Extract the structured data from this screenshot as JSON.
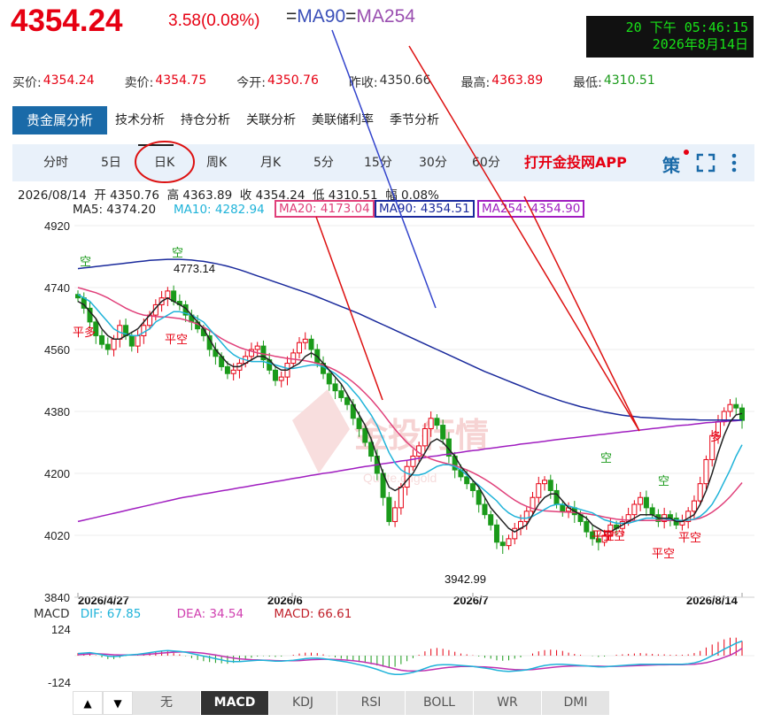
{
  "header": {
    "price": "4354.24",
    "change": "3.58(0.08%)",
    "ma_eq": {
      "eq1": "=",
      "ma90": "MA90",
      "eq2": "=",
      "ma254": "MA254"
    },
    "clock": {
      "line1": "20 下午 05:46:15",
      "line2": "2026年8月14日"
    }
  },
  "quotes": [
    {
      "label": "买价:",
      "value": "4354.24",
      "color": "#e60012"
    },
    {
      "label": "卖价:",
      "value": "4354.75",
      "color": "#e60012"
    },
    {
      "label": "今开:",
      "value": "4350.76",
      "color": "#e60012"
    },
    {
      "label": "昨收:",
      "value": "4350.66",
      "color": "#333333"
    },
    {
      "label": "最高:",
      "value": "4363.89",
      "color": "#e60012"
    },
    {
      "label": "最低:",
      "value": "4310.51",
      "color": "#1a9a1a"
    }
  ],
  "tabs": [
    "贵金属分析",
    "技术分析",
    "持仓分析",
    "关联分析",
    "美联储利率",
    "季节分析"
  ],
  "periods": [
    "分时",
    "5日",
    "日K",
    "周K",
    "月K",
    "5分",
    "15分",
    "30分",
    "60分"
  ],
  "app_link": "打开金投网APP",
  "toolbar_icon": "策",
  "ohlc_line": "2026/08/14  开 4350.76  高 4363.89  收 4354.24  低 4310.51  幅 0.08%",
  "ma_values": [
    {
      "label": "MA5: 4374.20",
      "color": "#222222"
    },
    {
      "label": "MA10: 4282.94",
      "color": "#1fb3d9"
    },
    {
      "label": "MA20: 4173.04",
      "color": "#e0407a"
    },
    {
      "label": "MA90: 4354.51",
      "color": "#1a2a9c"
    },
    {
      "label": "MA254: 4354.90",
      "color": "#a01ec0"
    }
  ],
  "macd_values": {
    "title": "MACD",
    "dif": "DIF: 67.85",
    "dea": "DEA: 34.54",
    "macd": "MACD: 66.61"
  },
  "bottom_tabs": [
    "无",
    "MACD",
    "KDJ",
    "RSI",
    "BOLL",
    "WR",
    "DMI"
  ],
  "watermark": {
    "text": "金投行情",
    "sub": "Quote.cngold"
  },
  "colors": {
    "up": "#e60012",
    "down": "#1a9a1a",
    "ma5": "#222222",
    "ma10": "#1fb3d9",
    "ma20": "#e0407a",
    "ma90": "#1a2a9c",
    "ma254": "#a01ec0",
    "accent": "#1a6aa8"
  },
  "chart_data": {
    "type": "candlestick",
    "y_ticks": [
      4920,
      4740,
      4560,
      4380,
      4200,
      4020,
      3840
    ],
    "ylim": [
      3840,
      4920
    ],
    "x_ticks": [
      "2026/4/27",
      "2026/6",
      "2026/7",
      "2026/8/14"
    ],
    "annotations": {
      "high": "4773.14",
      "low": "3942.99"
    },
    "signals": [
      "空",
      "平多",
      "空",
      "平空",
      "空",
      "平空",
      "平空",
      "空",
      "平空",
      "平空",
      "多"
    ],
    "close": [
      4710,
      4680,
      4640,
      4600,
      4575,
      4560,
      4590,
      4630,
      4600,
      4570,
      4600,
      4630,
      4660,
      4690,
      4710,
      4730,
      4700,
      4690,
      4660,
      4640,
      4620,
      4600,
      4560,
      4540,
      4510,
      4490,
      4500,
      4520,
      4540,
      4560,
      4570,
      4530,
      4500,
      4470,
      4480,
      4520,
      4550,
      4580,
      4590,
      4560,
      4520,
      4490,
      4460,
      4440,
      4420,
      4400,
      4360,
      4330,
      4290,
      4250,
      4200,
      4130,
      4060,
      4100,
      4160,
      4220,
      4250,
      4280,
      4330,
      4360,
      4340,
      4300,
      4250,
      4210,
      4190,
      4170,
      4150,
      4110,
      4080,
      4050,
      4000,
      3990,
      4010,
      4040,
      4060,
      4090,
      4130,
      4170,
      4180,
      4150,
      4110,
      4090,
      4100,
      4080,
      4060,
      4030,
      4010,
      4000,
      4020,
      4050,
      4040,
      4060,
      4080,
      4110,
      4130,
      4100,
      4080,
      4060,
      4080,
      4070,
      4050,
      4060,
      4090,
      4120,
      4170,
      4240,
      4310,
      4350,
      4380,
      4400,
      4390,
      4354
    ],
    "ma5": [
      4700,
      4690,
      4670,
      4650,
      4620,
      4600,
      4590,
      4590,
      4600,
      4610,
      4620,
      4640,
      4660,
      4680,
      4700,
      4710,
      4700,
      4690,
      4680,
      4660,
      4640,
      4620,
      4590,
      4560,
      4540,
      4520,
      4510,
      4510,
      4520,
      4530,
      4540,
      4540,
      4530,
      4510,
      4500,
      4500,
      4510,
      4520,
      4540,
      4550,
      4540,
      4520,
      4500,
      4480,
      4460,
      4430,
      4400,
      4370,
      4340,
      4300,
      4250,
      4200,
      4160,
      4150,
      4160,
      4180,
      4200,
      4230,
      4260,
      4290,
      4300,
      4290,
      4270,
      4250,
      4220,
      4200,
      4180,
      4160,
      4130,
      4100,
      4080,
      4060,
      4040,
      4030,
      4040,
      4050,
      4080,
      4110,
      4130,
      4140,
      4140,
      4120,
      4100,
      4090,
      4080,
      4070,
      4050,
      4040,
      4030,
      4030,
      4040,
      4050,
      4060,
      4070,
      4080,
      4080,
      4080,
      4070,
      4070,
      4070,
      4060,
      4060,
      4070,
      4080,
      4110,
      4150,
      4200,
      4260,
      4310,
      4350,
      4370,
      4374
    ],
    "ma10": [
      4720,
      4710,
      4700,
      4680,
      4660,
      4640,
      4620,
      4610,
      4605,
      4600,
      4600,
      4610,
      4620,
      4640,
      4650,
      4660,
      4670,
      4670,
      4665,
      4660,
      4650,
      4640,
      4620,
      4600,
      4580,
      4560,
      4545,
      4535,
      4530,
      4525,
      4525,
      4525,
      4520,
      4515,
      4510,
      4505,
      4505,
      4508,
      4512,
      4515,
      4515,
      4510,
      4500,
      4490,
      4475,
      4460,
      4440,
      4420,
      4395,
      4370,
      4340,
      4300,
      4260,
      4230,
      4210,
      4200,
      4195,
      4195,
      4200,
      4210,
      4220,
      4225,
      4225,
      4220,
      4210,
      4195,
      4180,
      4165,
      4150,
      4135,
      4120,
      4100,
      4085,
      4075,
      4070,
      4070,
      4075,
      4085,
      4095,
      4105,
      4110,
      4110,
      4105,
      4100,
      4095,
      4090,
      4085,
      4075,
      4065,
      4060,
      4055,
      4055,
      4055,
      4060,
      4065,
      4070,
      4070,
      4070,
      4068,
      4066,
      4064,
      4063,
      4064,
      4067,
      4075,
      4090,
      4110,
      4140,
      4175,
      4210,
      4250,
      4283
    ],
    "ma20": [
      4740,
      4735,
      4730,
      4725,
      4718,
      4710,
      4700,
      4690,
      4680,
      4672,
      4665,
      4660,
      4658,
      4656,
      4655,
      4654,
      4652,
      4650,
      4646,
      4640,
      4634,
      4625,
      4615,
      4603,
      4592,
      4582,
      4574,
      4566,
      4560,
      4555,
      4550,
      4547,
      4544,
      4540,
      4537,
      4534,
      4532,
      4530,
      4527,
      4524,
      4520,
      4515,
      4508,
      4500,
      4490,
      4478,
      4465,
      4450,
      4433,
      4415,
      4395,
      4373,
      4350,
      4328,
      4308,
      4290,
      4274,
      4260,
      4250,
      4242,
      4236,
      4231,
      4227,
      4222,
      4217,
      4210,
      4202,
      4193,
      4183,
      4172,
      4160,
      4147,
      4134,
      4122,
      4112,
      4104,
      4098,
      4094,
      4091,
      4090,
      4089,
      4088,
      4087,
      4086,
      4085,
      4083,
      4080,
      4077,
      4073,
      4070,
      4067,
      4065,
      4064,
      4063,
      4063,
      4063,
      4063,
      4063,
      4063,
      4063,
      4063,
      4063,
      4064,
      4066,
      4070,
      4077,
      4087,
      4100,
      4115,
      4132,
      4152,
      4173
    ],
    "ma90": [
      4795,
      4797,
      4799,
      4801,
      4803,
      4805,
      4807,
      4809,
      4811,
      4813,
      4815,
      4817,
      4819,
      4820,
      4821,
      4822,
      4822,
      4822,
      4821,
      4820,
      4818,
      4816,
      4813,
      4810,
      4806,
      4802,
      4797,
      4792,
      4786,
      4780,
      4774,
      4768,
      4762,
      4756,
      4750,
      4744,
      4738,
      4732,
      4726,
      4720,
      4713,
      4706,
      4699,
      4692,
      4685,
      4678,
      4671,
      4664,
      4656,
      4648,
      4640,
      4632,
      4624,
      4616,
      4608,
      4600,
      4592,
      4584,
      4576,
      4568,
      4560,
      4552,
      4544,
      4536,
      4528,
      4520,
      4512,
      4504,
      4496,
      4489,
      4482,
      4475,
      4468,
      4461,
      4454,
      4447,
      4440,
      4433,
      4427,
      4421,
      4415,
      4409,
      4404,
      4399,
      4394,
      4390,
      4386,
      4382,
      4378,
      4375,
      4372,
      4369,
      4367,
      4365,
      4363,
      4362,
      4361,
      4360,
      4359,
      4358,
      4357,
      4357,
      4356,
      4356,
      4355,
      4355,
      4355,
      4355,
      4355,
      4355,
      4355,
      4355
    ],
    "ma254": [
      4060,
      4064,
      4068,
      4072,
      4076,
      4080,
      4084,
      4088,
      4092,
      4096,
      4100,
      4104,
      4108,
      4112,
      4116,
      4120,
      4124,
      4128,
      4131,
      4134,
      4137,
      4140,
      4143,
      4146,
      4149,
      4152,
      4155,
      4158,
      4161,
      4164,
      4167,
      4170,
      4173,
      4176,
      4179,
      4182,
      4185,
      4188,
      4191,
      4194,
      4197,
      4200,
      4202,
      4205,
      4208,
      4211,
      4214,
      4217,
      4220,
      4222,
      4225,
      4228,
      4230,
      4233,
      4236,
      4238,
      4241,
      4244,
      4246,
      4249,
      4251,
      4254,
      4256,
      4259,
      4261,
      4264,
      4266,
      4268,
      4271,
      4273,
      4275,
      4278,
      4280,
      4282,
      4285,
      4287,
      4289,
      4291,
      4293,
      4296,
      4298,
      4300,
      4302,
      4304,
      4306,
      4308,
      4310,
      4312,
      4314,
      4316,
      4318,
      4320,
      4322,
      4324,
      4326,
      4328,
      4330,
      4332,
      4334,
      4336,
      4338,
      4340,
      4341,
      4343,
      4345,
      4347,
      4348,
      4350,
      4351,
      4352,
      4353,
      4355
    ],
    "macd": {
      "ylim": [
        -124,
        124
      ],
      "ticks": [
        124,
        -124
      ],
      "dif": [
        10,
        12,
        14,
        10,
        4,
        -2,
        -4,
        -2,
        2,
        4,
        6,
        10,
        14,
        18,
        22,
        24,
        22,
        20,
        16,
        10,
        4,
        -2,
        -8,
        -14,
        -20,
        -26,
        -28,
        -28,
        -26,
        -24,
        -22,
        -22,
        -24,
        -26,
        -26,
        -24,
        -22,
        -18,
        -14,
        -12,
        -12,
        -14,
        -18,
        -22,
        -26,
        -30,
        -36,
        -42,
        -48,
        -56,
        -64,
        -74,
        -84,
        -88,
        -88,
        -84,
        -78,
        -70,
        -60,
        -50,
        -44,
        -42,
        -42,
        -44,
        -46,
        -48,
        -50,
        -54,
        -58,
        -62,
        -68,
        -72,
        -74,
        -72,
        -70,
        -66,
        -60,
        -52,
        -46,
        -42,
        -40,
        -40,
        -42,
        -44,
        -46,
        -48,
        -50,
        -52,
        -52,
        -50,
        -48,
        -46,
        -44,
        -42,
        -40,
        -40,
        -40,
        -40,
        -40,
        -40,
        -40,
        -40,
        -38,
        -34,
        -26,
        -14,
        0,
        14,
        30,
        44,
        58,
        68
      ],
      "dea": [
        4,
        6,
        8,
        9,
        8,
        6,
        4,
        3,
        3,
        3,
        4,
        5,
        7,
        9,
        12,
        14,
        16,
        17,
        17,
        16,
        14,
        11,
        7,
        3,
        -2,
        -7,
        -11,
        -15,
        -17,
        -19,
        -20,
        -21,
        -22,
        -23,
        -24,
        -24,
        -24,
        -23,
        -21,
        -19,
        -18,
        -17,
        -17,
        -18,
        -19,
        -21,
        -24,
        -27,
        -31,
        -36,
        -41,
        -48,
        -55,
        -62,
        -68,
        -71,
        -72,
        -72,
        -70,
        -66,
        -62,
        -58,
        -55,
        -53,
        -51,
        -51,
        -51,
        -52,
        -53,
        -55,
        -57,
        -60,
        -63,
        -65,
        -66,
        -66,
        -65,
        -62,
        -59,
        -56,
        -53,
        -51,
        -49,
        -48,
        -48,
        -48,
        -49,
        -49,
        -50,
        -50,
        -50,
        -49,
        -48,
        -47,
        -46,
        -45,
        -44,
        -43,
        -43,
        -42,
        -42,
        -42,
        -41,
        -40,
        -37,
        -33,
        -26,
        -18,
        -8,
        2,
        16,
        34
      ]
    }
  }
}
